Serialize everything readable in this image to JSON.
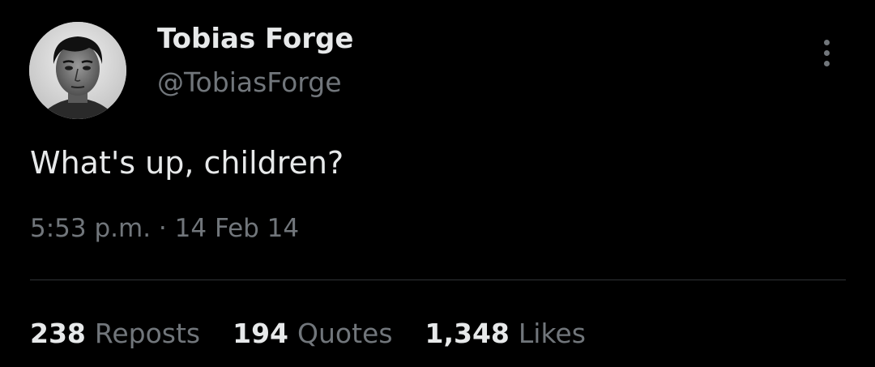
{
  "author": {
    "display_name": "Tobias Forge",
    "handle": "@TobiasForge",
    "avatar_icon": "user-avatar"
  },
  "tweet": {
    "text": "What's up, children?",
    "time": "5:53 p.m.",
    "separator": "·",
    "date": "14 Feb 14"
  },
  "menu": {
    "icon": "more-vertical-icon"
  },
  "stats": {
    "reposts": {
      "count": "238",
      "label": "Reposts"
    },
    "quotes": {
      "count": "194",
      "label": "Quotes"
    },
    "likes": {
      "count": "1,348",
      "label": "Likes"
    }
  },
  "colors": {
    "background": "#000000",
    "primary_text": "#e7e9ea",
    "secondary_text": "#71767b",
    "divider": "#2f3336"
  }
}
